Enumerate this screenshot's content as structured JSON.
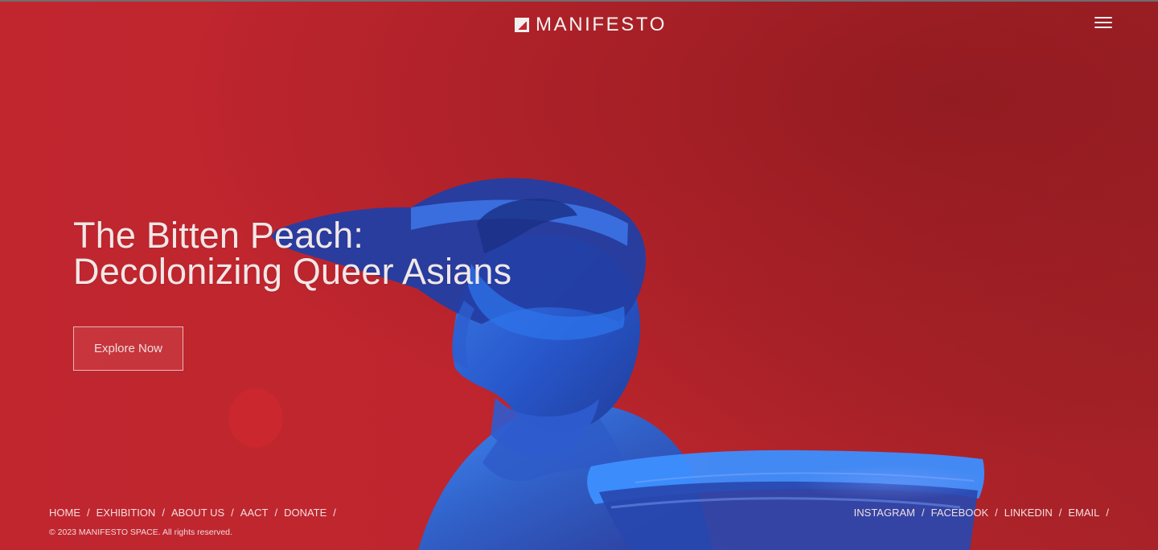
{
  "brand": {
    "name": "MANIFESTO",
    "logo_icon": "mountain-logo-icon"
  },
  "header": {
    "menu_icon": "hamburger-menu-icon"
  },
  "hero": {
    "title_line_1": "The Bitten Peach:",
    "title_line_2": "Decolonizing Queer Asians",
    "cta_label": "Explore Now"
  },
  "footer": {
    "nav": [
      {
        "label": "HOME"
      },
      {
        "label": "EXHIBITION"
      },
      {
        "label": "ABOUT US"
      },
      {
        "label": "AACT"
      },
      {
        "label": "DONATE"
      }
    ],
    "social": [
      {
        "label": "INSTAGRAM"
      },
      {
        "label": "FACEBOOK"
      },
      {
        "label": "LINKEDIN"
      },
      {
        "label": "EMAIL"
      }
    ],
    "separator": "/",
    "copyright": "© 2023 MANIFESTO SPACE. All rights reserved."
  },
  "colors": {
    "background": "#b8242b",
    "sculpture_blue": "#2f69d7",
    "text": "#f3e7e9"
  }
}
